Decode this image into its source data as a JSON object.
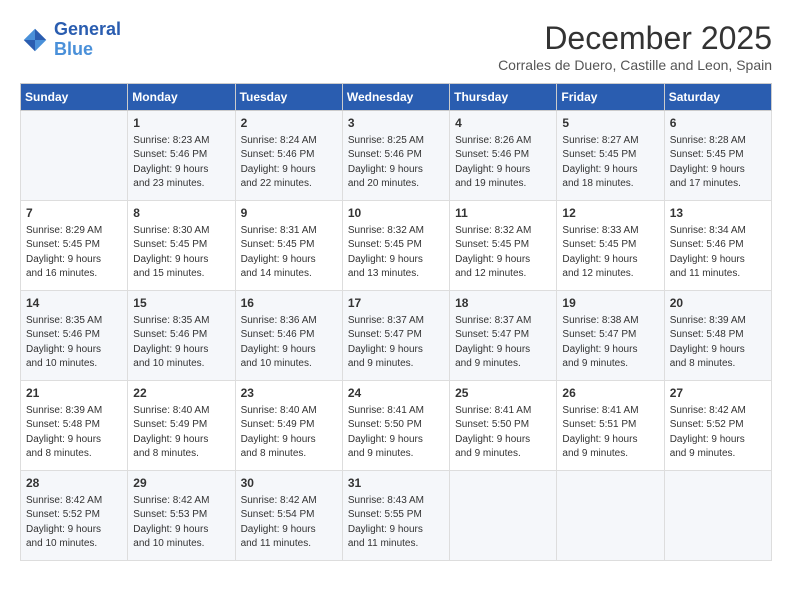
{
  "header": {
    "logo_line1": "General",
    "logo_line2": "Blue",
    "month": "December 2025",
    "location": "Corrales de Duero, Castille and Leon, Spain"
  },
  "weekdays": [
    "Sunday",
    "Monday",
    "Tuesday",
    "Wednesday",
    "Thursday",
    "Friday",
    "Saturday"
  ],
  "weeks": [
    [
      {
        "day": "",
        "info": ""
      },
      {
        "day": "1",
        "info": "Sunrise: 8:23 AM\nSunset: 5:46 PM\nDaylight: 9 hours\nand 23 minutes."
      },
      {
        "day": "2",
        "info": "Sunrise: 8:24 AM\nSunset: 5:46 PM\nDaylight: 9 hours\nand 22 minutes."
      },
      {
        "day": "3",
        "info": "Sunrise: 8:25 AM\nSunset: 5:46 PM\nDaylight: 9 hours\nand 20 minutes."
      },
      {
        "day": "4",
        "info": "Sunrise: 8:26 AM\nSunset: 5:46 PM\nDaylight: 9 hours\nand 19 minutes."
      },
      {
        "day": "5",
        "info": "Sunrise: 8:27 AM\nSunset: 5:45 PM\nDaylight: 9 hours\nand 18 minutes."
      },
      {
        "day": "6",
        "info": "Sunrise: 8:28 AM\nSunset: 5:45 PM\nDaylight: 9 hours\nand 17 minutes."
      }
    ],
    [
      {
        "day": "7",
        "info": "Sunrise: 8:29 AM\nSunset: 5:45 PM\nDaylight: 9 hours\nand 16 minutes."
      },
      {
        "day": "8",
        "info": "Sunrise: 8:30 AM\nSunset: 5:45 PM\nDaylight: 9 hours\nand 15 minutes."
      },
      {
        "day": "9",
        "info": "Sunrise: 8:31 AM\nSunset: 5:45 PM\nDaylight: 9 hours\nand 14 minutes."
      },
      {
        "day": "10",
        "info": "Sunrise: 8:32 AM\nSunset: 5:45 PM\nDaylight: 9 hours\nand 13 minutes."
      },
      {
        "day": "11",
        "info": "Sunrise: 8:32 AM\nSunset: 5:45 PM\nDaylight: 9 hours\nand 12 minutes."
      },
      {
        "day": "12",
        "info": "Sunrise: 8:33 AM\nSunset: 5:45 PM\nDaylight: 9 hours\nand 12 minutes."
      },
      {
        "day": "13",
        "info": "Sunrise: 8:34 AM\nSunset: 5:46 PM\nDaylight: 9 hours\nand 11 minutes."
      }
    ],
    [
      {
        "day": "14",
        "info": "Sunrise: 8:35 AM\nSunset: 5:46 PM\nDaylight: 9 hours\nand 10 minutes."
      },
      {
        "day": "15",
        "info": "Sunrise: 8:35 AM\nSunset: 5:46 PM\nDaylight: 9 hours\nand 10 minutes."
      },
      {
        "day": "16",
        "info": "Sunrise: 8:36 AM\nSunset: 5:46 PM\nDaylight: 9 hours\nand 10 minutes."
      },
      {
        "day": "17",
        "info": "Sunrise: 8:37 AM\nSunset: 5:47 PM\nDaylight: 9 hours\nand 9 minutes."
      },
      {
        "day": "18",
        "info": "Sunrise: 8:37 AM\nSunset: 5:47 PM\nDaylight: 9 hours\nand 9 minutes."
      },
      {
        "day": "19",
        "info": "Sunrise: 8:38 AM\nSunset: 5:47 PM\nDaylight: 9 hours\nand 9 minutes."
      },
      {
        "day": "20",
        "info": "Sunrise: 8:39 AM\nSunset: 5:48 PM\nDaylight: 9 hours\nand 8 minutes."
      }
    ],
    [
      {
        "day": "21",
        "info": "Sunrise: 8:39 AM\nSunset: 5:48 PM\nDaylight: 9 hours\nand 8 minutes."
      },
      {
        "day": "22",
        "info": "Sunrise: 8:40 AM\nSunset: 5:49 PM\nDaylight: 9 hours\nand 8 minutes."
      },
      {
        "day": "23",
        "info": "Sunrise: 8:40 AM\nSunset: 5:49 PM\nDaylight: 9 hours\nand 8 minutes."
      },
      {
        "day": "24",
        "info": "Sunrise: 8:41 AM\nSunset: 5:50 PM\nDaylight: 9 hours\nand 9 minutes."
      },
      {
        "day": "25",
        "info": "Sunrise: 8:41 AM\nSunset: 5:50 PM\nDaylight: 9 hours\nand 9 minutes."
      },
      {
        "day": "26",
        "info": "Sunrise: 8:41 AM\nSunset: 5:51 PM\nDaylight: 9 hours\nand 9 minutes."
      },
      {
        "day": "27",
        "info": "Sunrise: 8:42 AM\nSunset: 5:52 PM\nDaylight: 9 hours\nand 9 minutes."
      }
    ],
    [
      {
        "day": "28",
        "info": "Sunrise: 8:42 AM\nSunset: 5:52 PM\nDaylight: 9 hours\nand 10 minutes."
      },
      {
        "day": "29",
        "info": "Sunrise: 8:42 AM\nSunset: 5:53 PM\nDaylight: 9 hours\nand 10 minutes."
      },
      {
        "day": "30",
        "info": "Sunrise: 8:42 AM\nSunset: 5:54 PM\nDaylight: 9 hours\nand 11 minutes."
      },
      {
        "day": "31",
        "info": "Sunrise: 8:43 AM\nSunset: 5:55 PM\nDaylight: 9 hours\nand 11 minutes."
      },
      {
        "day": "",
        "info": ""
      },
      {
        "day": "",
        "info": ""
      },
      {
        "day": "",
        "info": ""
      }
    ]
  ]
}
